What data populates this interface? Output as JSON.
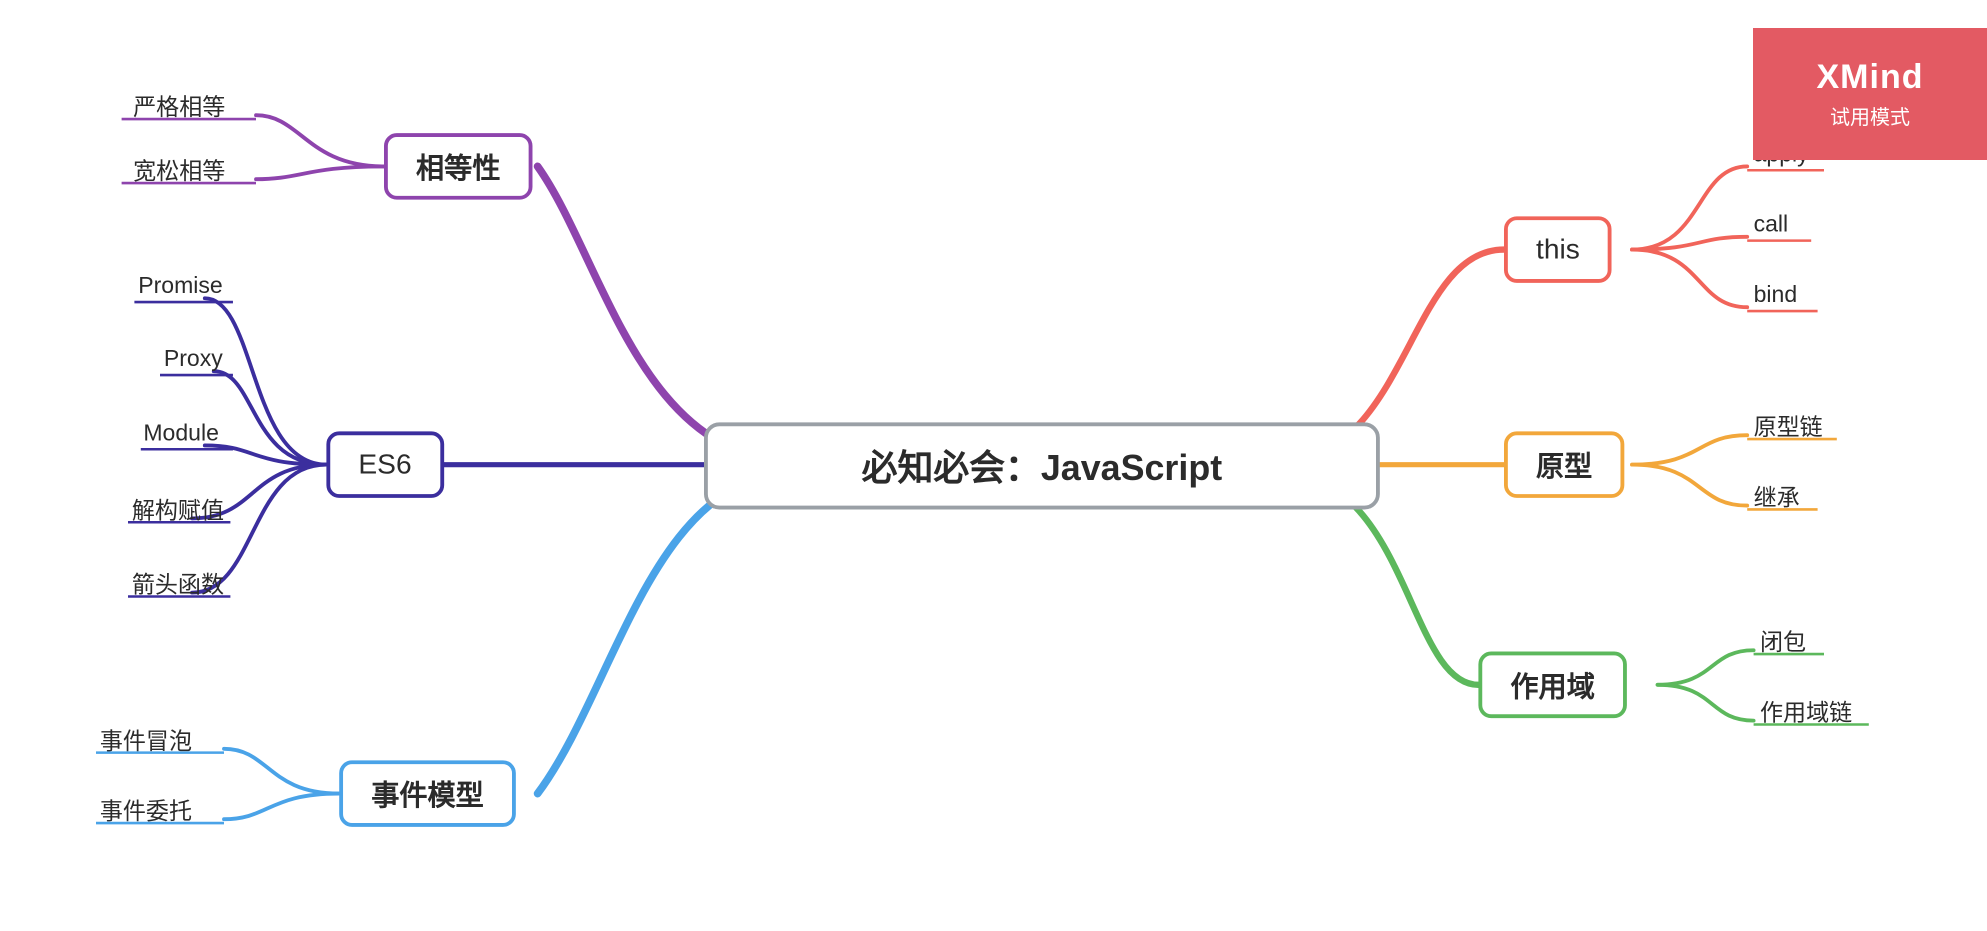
{
  "watermark": {
    "brand": "XMind",
    "trial": "试用模式"
  },
  "central": {
    "title": "必知必会：JavaScript"
  },
  "branches": {
    "equality": {
      "label": "相等性",
      "color": "#8e44ad",
      "children": [
        "严格相等",
        "宽松相等"
      ]
    },
    "es6": {
      "label": "ES6",
      "color": "#3b2e9e",
      "children": [
        "Promise",
        "Proxy",
        "Module",
        "解构赋值",
        "箭头函数"
      ]
    },
    "event": {
      "label": "事件模型",
      "color": "#4aa3e8",
      "children": [
        "事件冒泡",
        "事件委托"
      ]
    },
    "this": {
      "label": "this",
      "color": "#f1645a",
      "children": [
        "apply",
        "call",
        "bind"
      ]
    },
    "proto": {
      "label": "原型",
      "color": "#f2a73b",
      "children": [
        "原型链",
        "继承"
      ]
    },
    "scope": {
      "label": "作用域",
      "color": "#5cb85c",
      "children": [
        "闭包",
        "作用域链"
      ]
    }
  }
}
